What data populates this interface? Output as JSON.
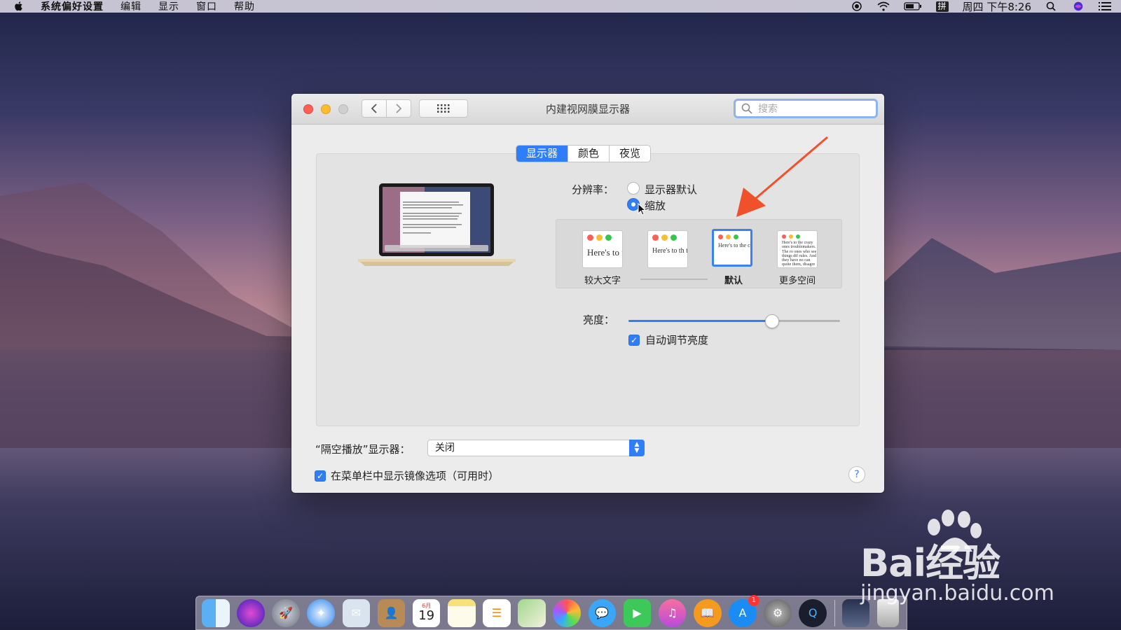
{
  "menubar": {
    "app": "系统偏好设置",
    "items": [
      "编辑",
      "显示",
      "窗口",
      "帮助"
    ],
    "input_method": "拼",
    "clock": "周四 下午8:26"
  },
  "window": {
    "title": "内建视网膜显示器",
    "search_placeholder": "搜索",
    "tabs": [
      "显示器",
      "颜色",
      "夜览"
    ],
    "active_tab": "显示器",
    "resolution": {
      "label": "分辨率：",
      "options": [
        "显示器默认",
        "缩放"
      ],
      "selected": "缩放"
    },
    "scale_options": [
      {
        "label": "较大文字",
        "preview": "Here's to troublem"
      },
      {
        "label": "",
        "preview": "Here's to th troublemak ones who"
      },
      {
        "label": "默认",
        "preview": "Here's to the cr troublemakers ones who see rules. And the"
      },
      {
        "label": "更多空间",
        "preview": "Here's to the crazy ones troublemakers. The ro ones who see things dif rules. And they have no can quote them, disagre Because they change t"
      }
    ],
    "selected_scale": "默认",
    "brightness": {
      "label": "亮度：",
      "value": 0.68,
      "auto_label": "自动调节亮度",
      "auto_checked": true
    },
    "airplay": {
      "label": "“隔空播放”显示器：",
      "value": "关闭"
    },
    "mirroring_label": "在菜单栏中显示镜像选项（可用时）",
    "mirroring_checked": true,
    "help": "?"
  },
  "dock": {
    "calendar_month": "6月",
    "calendar_day": "19",
    "appstore_badge": "1",
    "icons": [
      "finder-icon",
      "siri-icon",
      "launchpad-icon",
      "safari-icon",
      "mail-icon",
      "contacts-icon",
      "calendar-icon",
      "notes-icon",
      "reminders-icon",
      "maps-icon",
      "photos-icon",
      "messages-icon",
      "facetime-icon",
      "itunes-icon",
      "ibooks-icon",
      "appstore-icon",
      "system-preferences-icon",
      "quicktime-icon",
      "screen-icon",
      "trash-icon"
    ]
  },
  "watermark": {
    "brand": "Bai经验",
    "url": "jingyan.baidu.com"
  },
  "colors": {
    "accent": "#2f7ef7",
    "arrow": "#f0512a"
  }
}
